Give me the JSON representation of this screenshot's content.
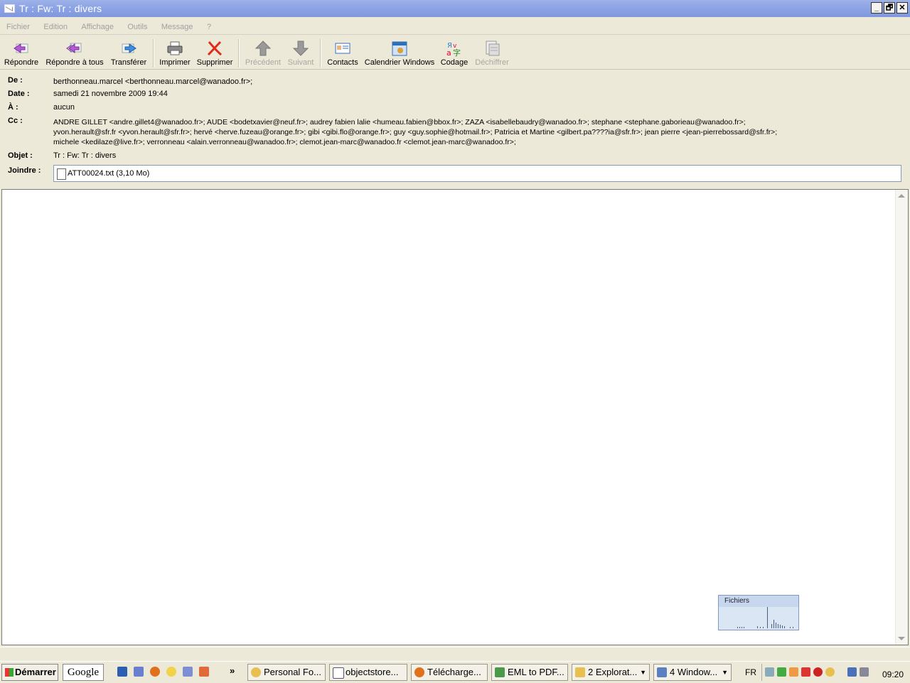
{
  "window": {
    "title": "Tr : Fw: Tr : divers",
    "controls": [
      "_",
      "🗗",
      "✕"
    ]
  },
  "menu": [
    "Fichier",
    "Edition",
    "Affichage",
    "Outils",
    "Message",
    "?"
  ],
  "toolbar": {
    "reply": "Répondre",
    "reply_all": "Répondre à tous",
    "forward": "Transférer",
    "print": "Imprimer",
    "delete": "Supprimer",
    "previous": "Précédent",
    "next": "Suivant",
    "contacts": "Contacts",
    "calendar": "Calendrier Windows",
    "encoding": "Codage",
    "decrypt": "Déchiffrer"
  },
  "header": {
    "from_label": "De :",
    "from_value": "berthonneau.marcel <berthonneau.marcel@wanadoo.fr>;",
    "date_label": "Date :",
    "date_value": "samedi 21 novembre 2009 19:44",
    "to_label": "À :",
    "to_value": "aucun",
    "cc_label": "Cc :",
    "cc_lines": [
      "ANDRE GILLET <andre.gillet4@wanadoo.fr>; AUDE <bodetxavier@neuf.fr>; audrey fabien lalie <humeau.fabien@bbox.fr>; ZAZA <isabellebaudry@wanadoo.fr>; stephane <stephane.gaborieau@wanadoo.fr>;",
      "yvon.herault@sfr.fr <yvon.herault@sfr.fr>; hervé <herve.fuzeau@orange.fr>; gibi <gibi.flo@orange.fr>; guy <guy.sophie@hotmail.fr>; Patricia et Martine <gilbert.pa????ia@sfr.fr>; jean pierre <jean-pierrebossard@sfr.fr>;",
      "michele <kedilaze@live.fr>; verronneau <alain.verronneau@wanadoo.fr>; clemot.jean-marc@wanadoo.fr <clemot.jean-marc@wanadoo.fr>;"
    ],
    "subject_label": "Objet :",
    "subject_value": "Tr : Fw: Tr : divers",
    "attach_label": "Joindre :",
    "attach_value": "ATT00024.txt (3,10 Mo)"
  },
  "widget": {
    "title": "Fichiers"
  },
  "taskbar": {
    "start": "Démarrer",
    "google": "Google",
    "more": "»",
    "tasks": [
      "Personal Fo...",
      "objectstore...",
      "Télécharge...",
      "EML to PDF...",
      "2 Explorat...",
      "4 Window..."
    ],
    "lang": "FR",
    "clock": "09:20"
  },
  "colors": {
    "title_bar": "#8ea6e6",
    "window_bg": "#ece9d8",
    "disabled_text": "#a0a0a0"
  }
}
